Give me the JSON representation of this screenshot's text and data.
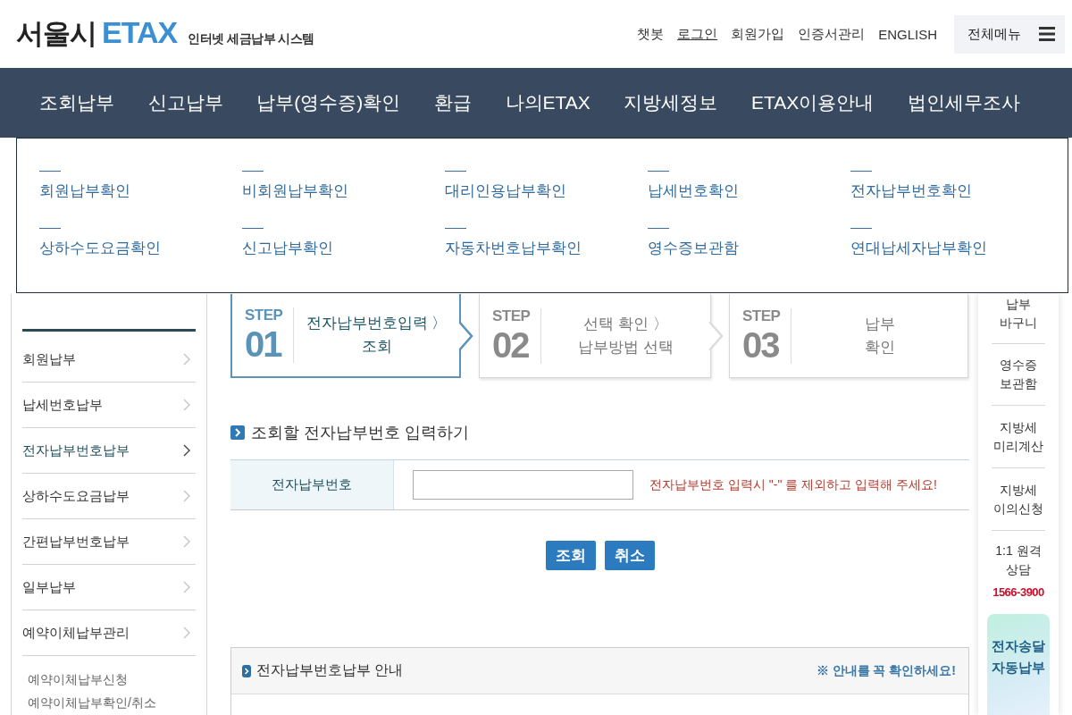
{
  "header": {
    "logo": {
      "city": "서울시",
      "brand": "ETAX",
      "tagline": "인터넷 세금납부 시스템"
    },
    "links": [
      {
        "label": "챗봇",
        "underlined": false
      },
      {
        "label": "로그인",
        "underlined": true
      },
      {
        "label": "회원가입",
        "underlined": false
      },
      {
        "label": "인증서관리",
        "underlined": false
      },
      {
        "label": "ENGLISH",
        "underlined": false
      }
    ],
    "all_menu_button": "전체메뉴"
  },
  "main_nav": [
    "조회납부",
    "신고납부",
    "납부(영수증)확인",
    "환급",
    "나의ETAX",
    "지방세정보",
    "ETAX이용안내",
    "법인세무조사"
  ],
  "dropdown": {
    "items": [
      "회원납부확인",
      "비회원납부확인",
      "대리인용납부확인",
      "납세번호확인",
      "전자납부번호확인",
      "상하수도요금확인",
      "신고납부확인",
      "자동차번호납부확인",
      "영수증보관함",
      "연대납세자납부확인"
    ]
  },
  "sidebar": {
    "items": [
      {
        "label": "회원납부",
        "selected": false
      },
      {
        "label": "납세번호납부",
        "selected": false
      },
      {
        "label": "전자납부번호납부",
        "selected": true
      },
      {
        "label": "상하수도요금납부",
        "selected": false
      },
      {
        "label": "간편납부번호납부",
        "selected": false
      },
      {
        "label": "일부납부",
        "selected": false
      },
      {
        "label": "예약이체납부관리",
        "selected": false
      }
    ],
    "sub_items": [
      "예약이체납부신청",
      "예약이체납부확인/취소"
    ]
  },
  "steps": [
    {
      "step_label": "STEP",
      "number": "01",
      "text": "전자납부번호입력 〉\n조회",
      "selected": true
    },
    {
      "step_label": "STEP",
      "number": "02",
      "text": "선택 확인 〉\n납부방법 선택",
      "selected": false
    },
    {
      "step_label": "STEP",
      "number": "03",
      "text": "납부\n확인",
      "selected": false
    }
  ],
  "section_title": "조회할 전자납부번호 입력하기",
  "form": {
    "label": "전자납부번호",
    "hint": "전자납부번호 입력시 \"-\" 를 제외하고 입력해 주세요!"
  },
  "buttons": [
    {
      "label": "조회"
    },
    {
      "label": "취소"
    }
  ],
  "info_box": {
    "title": "전자납부번호납부 안내",
    "note": "※ 안내를 꼭 확인하세요!"
  },
  "quick_menu": {
    "items": [
      {
        "label": "납부\n바구니"
      },
      {
        "label": "영수증\n보관함"
      },
      {
        "label": "지방세\n미리계산"
      },
      {
        "label": "지방세\n이의신청"
      },
      {
        "label": "1:1 원격\n상담",
        "phone": "1566-3900"
      }
    ],
    "promo": "전자송달\n자동납부"
  }
}
